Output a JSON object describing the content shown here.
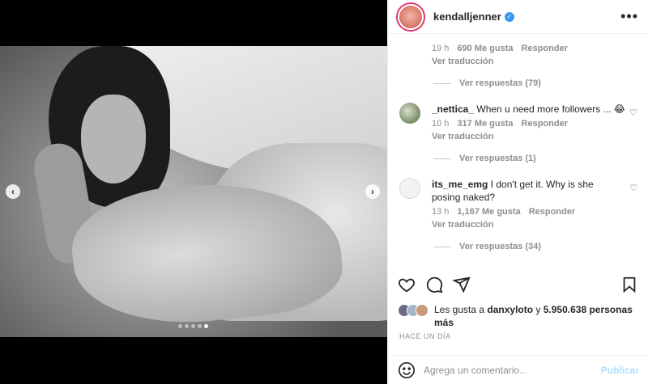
{
  "header": {
    "username": "kendalljenner",
    "more_label": "•••"
  },
  "media": {
    "prev_label": "‹",
    "next_label": "›",
    "dots_count": 5,
    "active_dot": 4
  },
  "comments": {
    "top": {
      "time": "19 h",
      "likes": "690 Me gusta",
      "reply": "Responder",
      "translate": "Ver traducción",
      "view_replies": "Ver respuestas (79)"
    },
    "items": [
      {
        "user": "_nettica_",
        "text": "When u need more followers ... 😂",
        "time": "10 h",
        "likes": "317 Me gusta",
        "reply": "Responder",
        "translate": "Ver traducción",
        "view_replies": "Ver respuestas (1)"
      },
      {
        "user": "its_me_emg",
        "text": "I don't get it. Why is she posing naked?",
        "time": "13 h",
        "likes": "1,167 Me gusta",
        "reply": "Responder",
        "translate": "Ver traducción",
        "view_replies": "Ver respuestas (34)"
      }
    ]
  },
  "likes": {
    "prefix": "Les gusta a ",
    "user": "danxyloto",
    "middle": " y ",
    "count": "5.950.638 personas más"
  },
  "posted": "HACE UN DÍA",
  "composer": {
    "placeholder": "Agrega un comentario...",
    "publish": "Publicar"
  },
  "colors": {
    "verified": "#3897f0",
    "publish_disabled": "#b2dffc",
    "muted": "#8e8e8e"
  }
}
